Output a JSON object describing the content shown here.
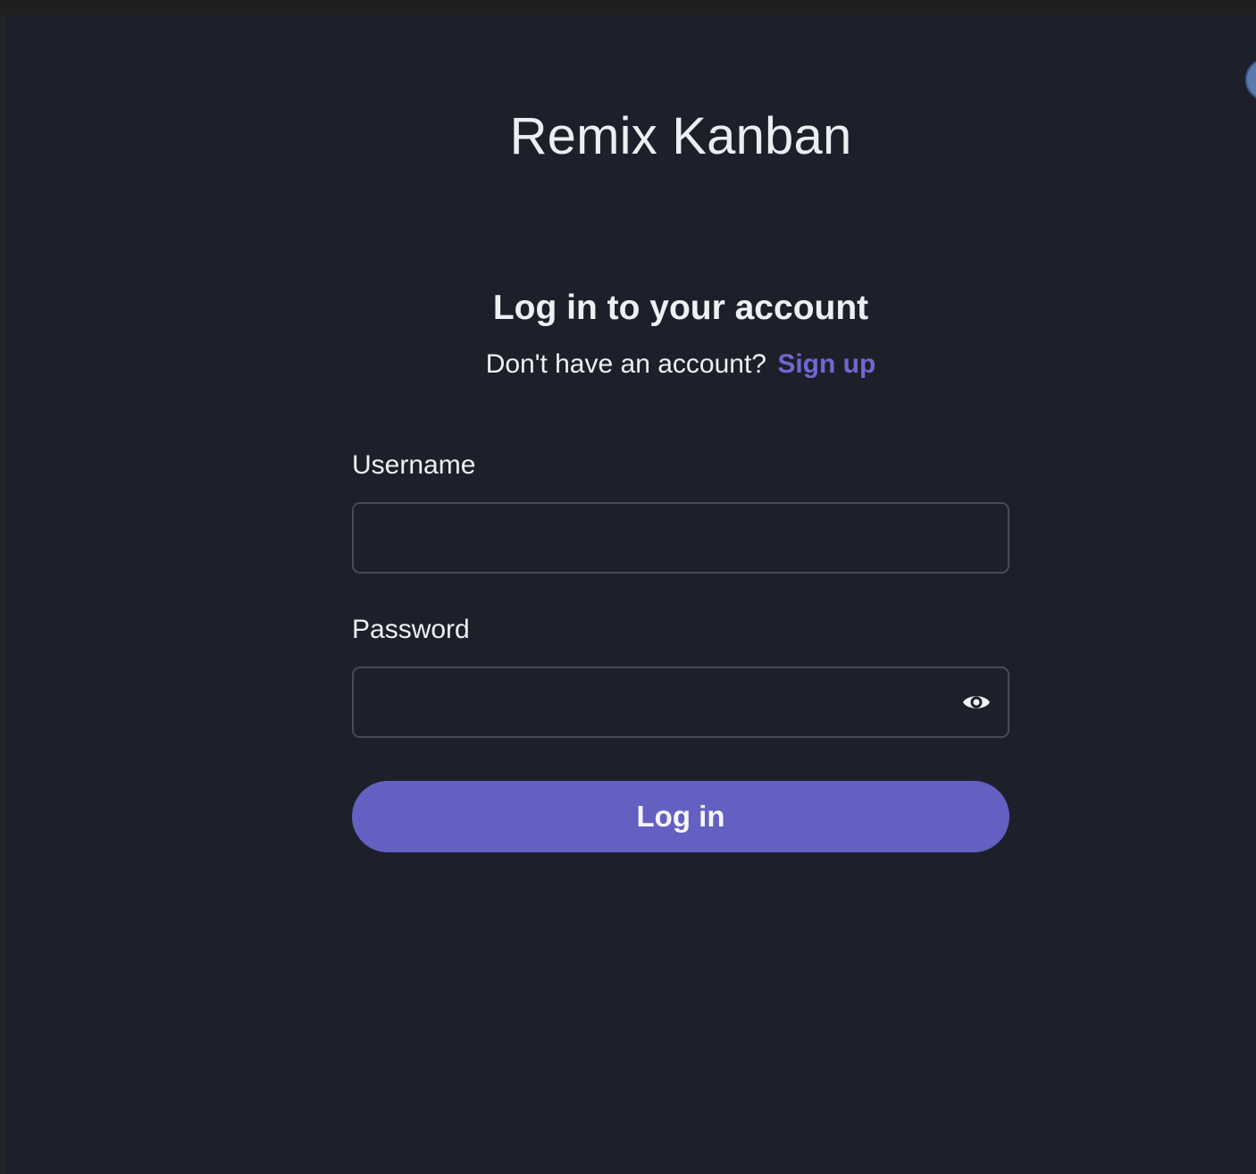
{
  "app": {
    "title": "Remix Kanban"
  },
  "login": {
    "heading": "Log in to your account",
    "signup_prompt": "Don't have an account?",
    "signup_link": "Sign up",
    "username_label": "Username",
    "username_value": "",
    "password_label": "Password",
    "password_value": "",
    "submit_label": "Log in"
  },
  "icons": {
    "password_toggle": "eye-icon"
  },
  "colors": {
    "background": "#1d202a",
    "accent": "#6360c1",
    "link": "#7068d0",
    "input_border": "#474b55",
    "text": "#eef0f3"
  }
}
